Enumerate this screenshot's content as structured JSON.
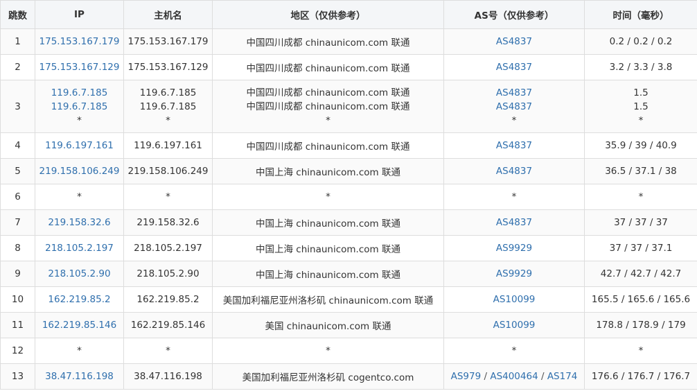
{
  "headers": {
    "hop": "跳数",
    "ip": "IP",
    "host": "主机名",
    "region": "地区（仅供参考）",
    "as": "AS号（仅供参考）",
    "time": "时间（毫秒）"
  },
  "rows": [
    {
      "hop": "1",
      "lines": [
        {
          "ip": "175.153.167.179",
          "host": "175.153.167.179",
          "region": "中国四川成都 chinaunicom.com 联通",
          "as": [
            "AS4837"
          ]
        }
      ],
      "time": "0.2 / 0.2 / 0.2"
    },
    {
      "hop": "2",
      "lines": [
        {
          "ip": "175.153.167.129",
          "host": "175.153.167.129",
          "region": "中国四川成都 chinaunicom.com 联通",
          "as": [
            "AS4837"
          ]
        }
      ],
      "time": "3.2 / 3.3 / 3.8"
    },
    {
      "hop": "3",
      "lines": [
        {
          "ip": "119.6.7.185",
          "host": "119.6.7.185",
          "region": "中国四川成都 chinaunicom.com 联通",
          "as": [
            "AS4837"
          ],
          "time": "1.5"
        },
        {
          "ip": "119.6.7.185",
          "host": "119.6.7.185",
          "region": "中国四川成都 chinaunicom.com 联通",
          "as": [
            "AS4837"
          ],
          "time": "1.5"
        },
        {
          "ip": "*",
          "host": "*",
          "region": "*",
          "as": [
            "*"
          ],
          "time": "*"
        }
      ]
    },
    {
      "hop": "4",
      "lines": [
        {
          "ip": "119.6.197.161",
          "host": "119.6.197.161",
          "region": "中国四川成都 chinaunicom.com 联通",
          "as": [
            "AS4837"
          ]
        }
      ],
      "time": "35.9 / 39 / 40.9"
    },
    {
      "hop": "5",
      "lines": [
        {
          "ip": "219.158.106.249",
          "host": "219.158.106.249",
          "region": "中国上海 chinaunicom.com 联通",
          "as": [
            "AS4837"
          ]
        }
      ],
      "time": "36.5 / 37.1 / 38"
    },
    {
      "hop": "6",
      "lines": [
        {
          "ip": "*",
          "host": "*",
          "region": "*",
          "as": [
            "*"
          ]
        }
      ],
      "time": "*"
    },
    {
      "hop": "7",
      "lines": [
        {
          "ip": "219.158.32.6",
          "host": "219.158.32.6",
          "region": "中国上海 chinaunicom.com 联通",
          "as": [
            "AS4837"
          ]
        }
      ],
      "time": "37 / 37 / 37"
    },
    {
      "hop": "8",
      "lines": [
        {
          "ip": "218.105.2.197",
          "host": "218.105.2.197",
          "region": "中国上海 chinaunicom.com 联通",
          "as": [
            "AS9929"
          ]
        }
      ],
      "time": "37 / 37 / 37.1"
    },
    {
      "hop": "9",
      "lines": [
        {
          "ip": "218.105.2.90",
          "host": "218.105.2.90",
          "region": "中国上海 chinaunicom.com 联通",
          "as": [
            "AS9929"
          ]
        }
      ],
      "time": "42.7 / 42.7 / 42.7"
    },
    {
      "hop": "10",
      "lines": [
        {
          "ip": "162.219.85.2",
          "host": "162.219.85.2",
          "region": "美国加利福尼亚州洛杉矶 chinaunicom.com 联通",
          "as": [
            "AS10099"
          ]
        }
      ],
      "time": "165.5 / 165.6 / 165.6"
    },
    {
      "hop": "11",
      "lines": [
        {
          "ip": "162.219.85.146",
          "host": "162.219.85.146",
          "region": "美国 chinaunicom.com 联通",
          "as": [
            "AS10099"
          ]
        }
      ],
      "time": "178.8 / 178.9 / 179"
    },
    {
      "hop": "12",
      "lines": [
        {
          "ip": "*",
          "host": "*",
          "region": "*",
          "as": [
            "*"
          ]
        }
      ],
      "time": "*"
    },
    {
      "hop": "13",
      "lines": [
        {
          "ip": "38.47.116.198",
          "host": "38.47.116.198",
          "region": "美国加利福尼亚州洛杉矶 cogentco.com",
          "as": [
            "AS979",
            "AS400464",
            "AS174"
          ]
        }
      ],
      "time": "176.6 / 176.7 / 176.7"
    }
  ],
  "as_separator": " / ",
  "colors": {
    "link": "#2f6fad",
    "header_bg": "#f4f6f8",
    "border": "#dddddd",
    "stripe": "#fafafa"
  }
}
